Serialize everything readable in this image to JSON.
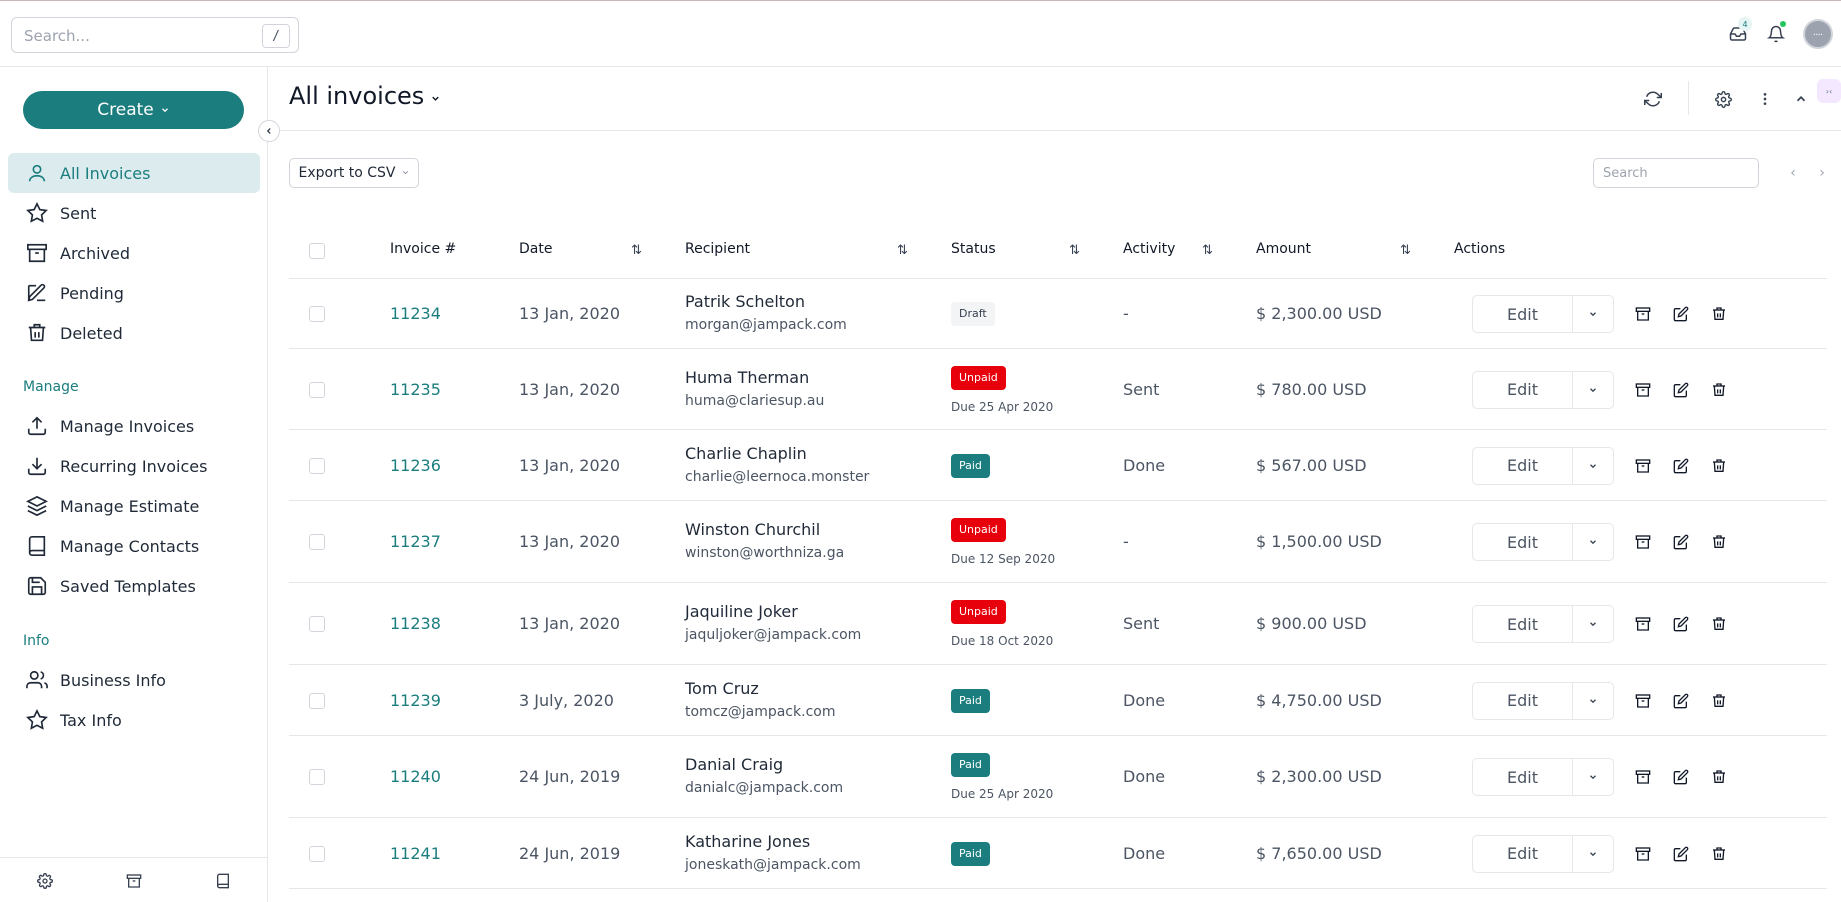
{
  "topbar": {
    "search_placeholder": "Search...",
    "search_shortcut": "/",
    "inbox_count": "4",
    "avatar_text": "••••"
  },
  "sidebar": {
    "create_label": "Create",
    "items": [
      {
        "label": "All Invoices",
        "icon": "user-icon",
        "active": true
      },
      {
        "label": "Sent",
        "icon": "star-icon"
      },
      {
        "label": "Archived",
        "icon": "archive-icon"
      },
      {
        "label": "Pending",
        "icon": "pencil-icon"
      },
      {
        "label": "Deleted",
        "icon": "trash-icon"
      }
    ],
    "manage_label": "Manage",
    "manage_items": [
      {
        "label": "Manage Invoices",
        "icon": "upload-icon"
      },
      {
        "label": "Recurring Invoices",
        "icon": "download-icon"
      },
      {
        "label": "Manage Estimate",
        "icon": "layers-icon"
      },
      {
        "label": "Manage Contacts",
        "icon": "book-icon"
      },
      {
        "label": "Saved Templates",
        "icon": "save-icon"
      }
    ],
    "info_label": "Info",
    "info_items": [
      {
        "label": "Business Info",
        "icon": "users-icon"
      },
      {
        "label": "Tax Info",
        "icon": "star-icon"
      }
    ]
  },
  "main": {
    "title": "All invoices",
    "export_label": "Export to CSV",
    "search_placeholder": "Search",
    "columns": {
      "invoice": "Invoice #",
      "date": "Date",
      "recipient": "Recipient",
      "status": "Status",
      "activity": "Activity",
      "amount": "Amount",
      "actions": "Actions"
    },
    "edit_label": "Edit",
    "rows": [
      {
        "invoice": "11234",
        "date": "13 Jan, 2020",
        "name": "Patrik Schelton",
        "email": "morgan@jampack.com",
        "status": "Draft",
        "status_type": "draft",
        "due": "",
        "activity": "-",
        "amount": "$ 2,300.00 USD"
      },
      {
        "invoice": "11235",
        "date": "13 Jan, 2020",
        "name": "Huma Therman",
        "email": "huma@clariesup.au",
        "status": "Unpaid",
        "status_type": "unpaid",
        "due": "Due 25 Apr 2020",
        "activity": "Sent",
        "amount": "$ 780.00 USD"
      },
      {
        "invoice": "11236",
        "date": "13 Jan, 2020",
        "name": "Charlie Chaplin",
        "email": "charlie@leernoca.monster",
        "status": "Paid",
        "status_type": "paid",
        "due": "",
        "activity": "Done",
        "amount": "$ 567.00 USD"
      },
      {
        "invoice": "11237",
        "date": "13 Jan, 2020",
        "name": "Winston Churchil",
        "email": "winston@worthniza.ga",
        "status": "Unpaid",
        "status_type": "unpaid",
        "due": "Due 12 Sep 2020",
        "activity": "-",
        "amount": "$ 1,500.00 USD"
      },
      {
        "invoice": "11238",
        "date": "13 Jan, 2020",
        "name": "Jaquiline Joker",
        "email": "jaquljoker@jampack.com",
        "status": "Unpaid",
        "status_type": "unpaid",
        "due": "Due 18 Oct 2020",
        "activity": "Sent",
        "amount": "$ 900.00 USD"
      },
      {
        "invoice": "11239",
        "date": "3 July, 2020",
        "name": "Tom Cruz",
        "email": "tomcz@jampack.com",
        "status": "Paid",
        "status_type": "paid",
        "due": "",
        "activity": "Done",
        "amount": "$ 4,750.00 USD"
      },
      {
        "invoice": "11240",
        "date": "24 Jun, 2019",
        "name": "Danial Craig",
        "email": "danialc@jampack.com",
        "status": "Paid",
        "status_type": "paid",
        "due": "Due 25 Apr 2020",
        "activity": "Done",
        "amount": "$ 2,300.00 USD"
      },
      {
        "invoice": "11241",
        "date": "24 Jun, 2019",
        "name": "Katharine Jones",
        "email": "joneskath@jampack.com",
        "status": "Paid",
        "status_type": "paid",
        "due": "",
        "activity": "Done",
        "amount": "$ 7,650.00 USD"
      }
    ]
  },
  "colors": {
    "accent": "#1b7d7e",
    "unpaid": "#e7000b",
    "active_bg": "#dcecee"
  }
}
